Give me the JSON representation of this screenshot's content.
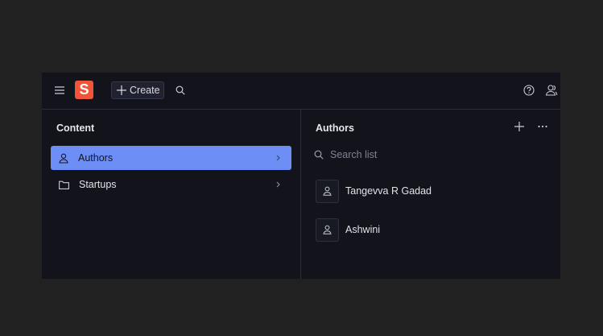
{
  "header": {
    "logo_letter": "S",
    "create_label": "Create"
  },
  "content_panel": {
    "title": "Content",
    "items": [
      {
        "label": "Authors",
        "icon": "person-icon",
        "active": true
      },
      {
        "label": "Startups",
        "icon": "folder-icon",
        "active": false
      }
    ]
  },
  "authors_panel": {
    "title": "Authors",
    "search_placeholder": "Search list",
    "authors": [
      {
        "name": "Tangevva R Gadad"
      },
      {
        "name": "Ashwini"
      }
    ]
  },
  "colors": {
    "accent": "#6d8ef5",
    "logo": "#f05439",
    "background": "#13141b"
  }
}
